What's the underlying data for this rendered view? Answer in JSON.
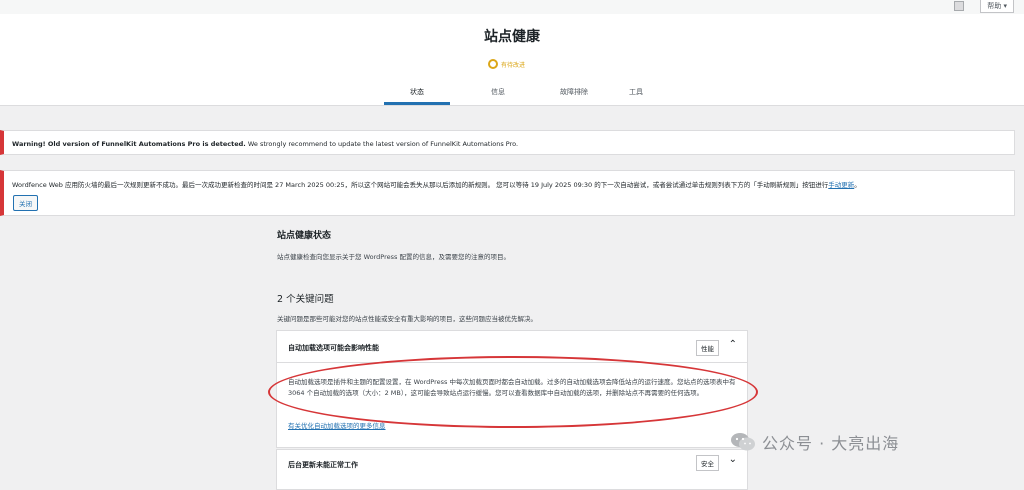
{
  "topbar": {
    "help_label": "帮助 ▾"
  },
  "header": {
    "title": "站点健康",
    "status_label": "有待改进",
    "tabs": [
      {
        "label": "状态",
        "active": true
      },
      {
        "label": "信息",
        "active": false
      },
      {
        "label": "故障排除",
        "active": false
      },
      {
        "label": "工具",
        "active": false
      }
    ]
  },
  "notices": {
    "funnelkit_bold": "Warning! Old version of FunnelKit Automations Pro is detected.",
    "funnelkit_rest": " We strongly recommend to update the latest version of FunnelKit Automations Pro.",
    "wordfence_text": "Wordfence Web 应用防火墙的最后一次规则更新不成功。最后一次成功更新检查的时间是 27 March 2025 00:25，所以这个网站可能会丢失从那以后添加的新规则。 您可以等待 19 July 2025 09:30 的下一次自动尝试，或者尝试通过单击规则列表下方的「手动刷新规则」按钮进行",
    "wordfence_link": "手动更新",
    "wordfence_end": "。",
    "dismiss_label": "关闭"
  },
  "main": {
    "section_title": "站点健康状态",
    "section_desc": "站点健康检查向您显示关于您 WordPress 配置的信息，及需要您的注意的项目。",
    "issues_heading": "2 个关键问题",
    "issues_desc": "关键问题是那些可能对您的站点性能或安全有重大影响的项目，这些问题应当被优先解决。",
    "issues": [
      {
        "title": "自动加载选项可能会影响性能",
        "badge": "性能",
        "expanded": true,
        "body": "自动加载选项是插件和主题的配置设置，在 WordPress 中每次加载页面时都会自动加载。过多的自动加载选项会降低站点的运行速度。您站点的选项表中有 3064 个自动加载的选项（大小：2 MB），这可能会导致站点运行缓慢。您可以查看数据库中自动加载的选项，并删除站点不再需要的任何选项。",
        "link": "有关优化自动加载选项的更多信息"
      },
      {
        "title": "后台更新未能正常工作",
        "badge": "安全",
        "expanded": false
      }
    ]
  },
  "watermark": {
    "text": "公众号 · 大亮出海"
  },
  "colors": {
    "accent": "#2271b1",
    "warning": "#dba617",
    "error": "#d63638"
  }
}
